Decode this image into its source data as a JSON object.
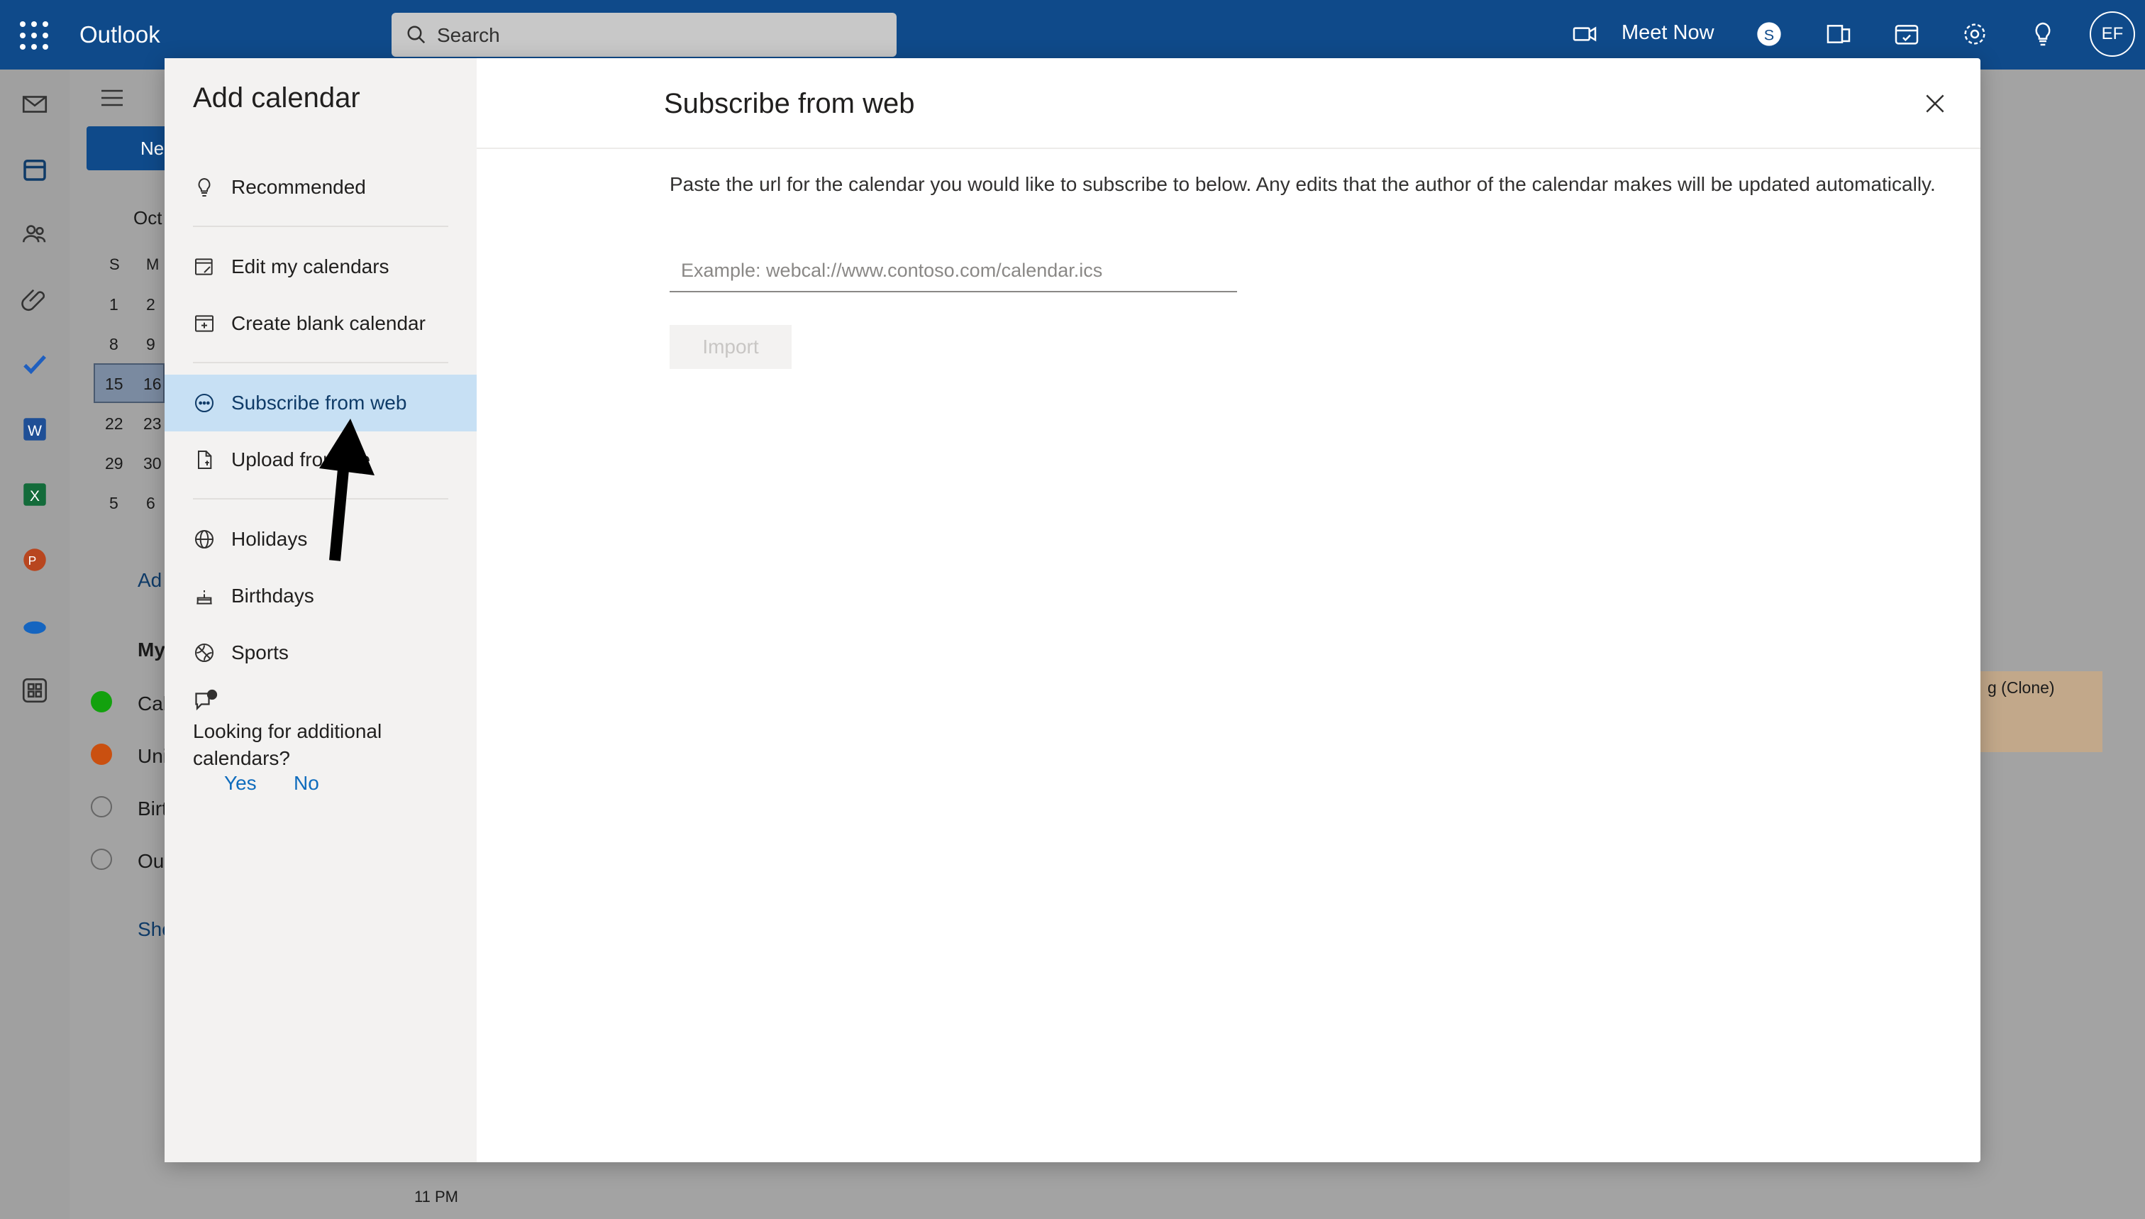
{
  "app": {
    "name": "Outlook"
  },
  "topbar": {
    "search_placeholder": "Search",
    "meet_now": "Meet Now",
    "avatar_initials": "EF"
  },
  "background": {
    "new_event_fragment": "Ne",
    "month_fragment": "Oct",
    "weekday_headers": [
      "S",
      "M"
    ],
    "mini_calendar_rows": [
      [
        "1",
        "2"
      ],
      [
        "8",
        "9"
      ],
      [
        "15",
        "16"
      ],
      [
        "22",
        "23"
      ],
      [
        "29",
        "30"
      ],
      [
        "5",
        "6"
      ]
    ],
    "add_calendar_fragment": "Ad",
    "my_calendars_fragment": "My",
    "calendars": [
      {
        "name": "Cal",
        "checked": true,
        "color": "#13a10e"
      },
      {
        "name": "Uni",
        "checked": true,
        "color": "#ca5010"
      },
      {
        "name": "Birt",
        "checked": false,
        "color": "#a3a3a3"
      },
      {
        "name": "Ou",
        "checked": false,
        "color": "#a3a3a3"
      }
    ],
    "show_more_fragment": "Sho",
    "event_fragment": "g (Clone)",
    "time_label": "11 PM"
  },
  "dialog": {
    "title": "Add calendar",
    "nav": [
      {
        "label": "Recommended",
        "icon": "lightbulb-icon"
      },
      {
        "label": "Edit my calendars",
        "icon": "edit-calendar-icon"
      },
      {
        "label": "Create blank calendar",
        "icon": "add-calendar-icon"
      },
      {
        "label": "Subscribe from web",
        "icon": "link-icon",
        "selected": true
      },
      {
        "label": "Upload from file",
        "icon": "file-upload-icon"
      },
      {
        "label": "Holidays",
        "icon": "globe-icon"
      },
      {
        "label": "Birthdays",
        "icon": "cake-icon"
      },
      {
        "label": "Sports",
        "icon": "ball-icon"
      }
    ],
    "feedback_prompt": "Looking for additional calendars?",
    "feedback_yes": "Yes",
    "feedback_no": "No",
    "main": {
      "heading": "Subscribe from web",
      "description": "Paste the url for the calendar you would like to subscribe to below. Any edits that the author of the calendar makes will be updated automatically.",
      "url_placeholder": "Example: webcal://www.contoso.com/calendar.ics",
      "url_value": "",
      "import_label": "Import"
    }
  }
}
